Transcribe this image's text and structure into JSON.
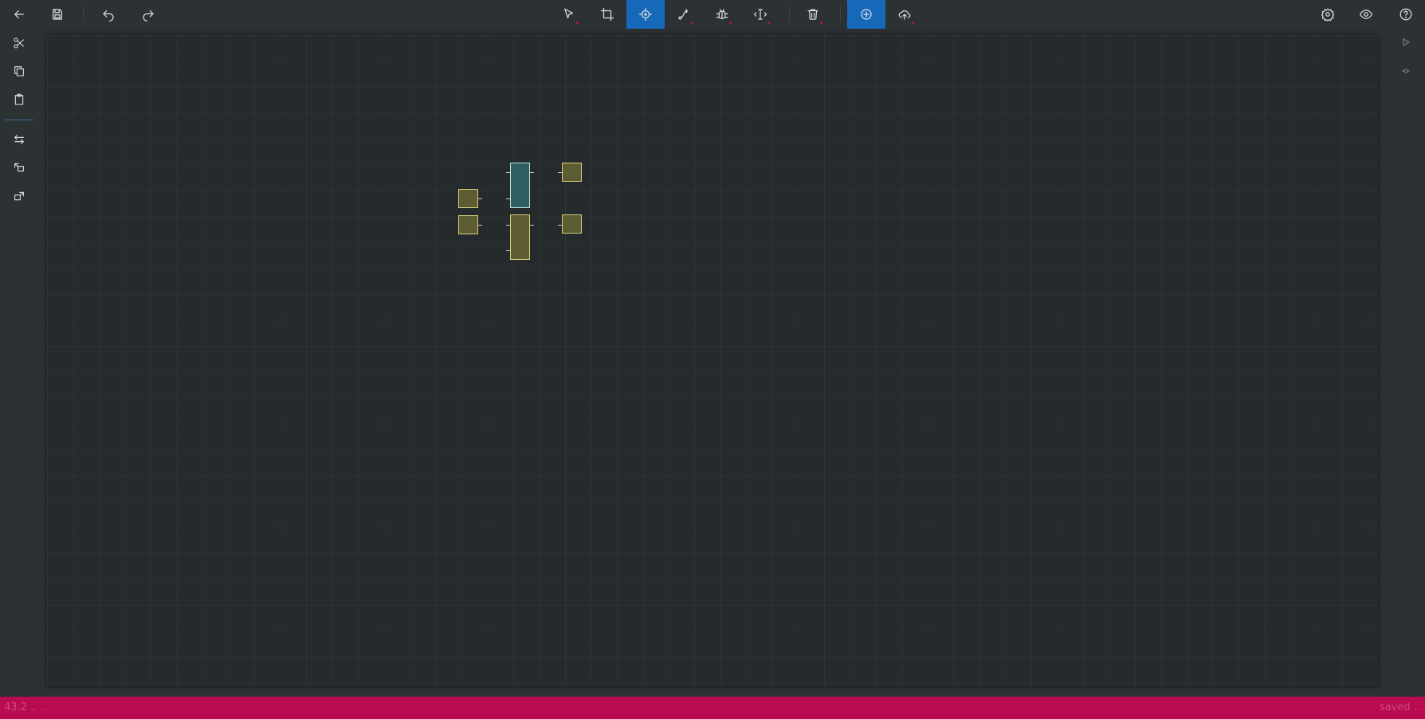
{
  "toolbar": {
    "left": [
      {
        "name": "back-button",
        "icon": "arrow-left-icon"
      },
      {
        "name": "save-button",
        "icon": "floppy-disk-icon"
      },
      {
        "name": "undo-button",
        "icon": "undo-icon"
      },
      {
        "name": "redo-button",
        "icon": "redo-icon"
      }
    ],
    "center": [
      {
        "name": "select-tool-button",
        "icon": "cursor-arrow-icon",
        "active": false
      },
      {
        "name": "crop-tool-button",
        "icon": "crop-icon",
        "active": false
      },
      {
        "name": "move-tool-button",
        "icon": "crosshair-move-icon",
        "active": true
      },
      {
        "name": "wire-tool-button",
        "icon": "wire-route-icon",
        "active": false
      },
      {
        "name": "debug-tool-button",
        "icon": "bug-icon",
        "active": false
      },
      {
        "name": "text-tool-button",
        "icon": "text-cursor-icon",
        "active": false
      },
      {
        "name": "delete-button",
        "icon": "trash-icon",
        "active": false
      },
      {
        "name": "add-component-button",
        "icon": "plus-circle-icon",
        "active": true
      },
      {
        "name": "cloud-upload-button",
        "icon": "cloud-upload-icon",
        "active": false
      }
    ],
    "right": [
      {
        "name": "settings-button",
        "icon": "gear-icon"
      },
      {
        "name": "view-button",
        "icon": "eye-icon"
      },
      {
        "name": "help-button",
        "icon": "help-circle-icon"
      }
    ]
  },
  "sidebar": {
    "items": [
      {
        "name": "cut-button",
        "icon": "scissors-icon"
      },
      {
        "name": "copy-button",
        "icon": "copy-icon"
      },
      {
        "name": "paste-button",
        "icon": "clipboard-icon"
      },
      {
        "name": "swap-button",
        "icon": "swap-arrows-icon"
      },
      {
        "name": "group-button",
        "icon": "group-icon"
      },
      {
        "name": "ungroup-button",
        "icon": "ungroup-icon"
      }
    ]
  },
  "right_panel": [
    {
      "name": "play-button",
      "icon": "play-icon"
    },
    {
      "name": "step-button",
      "icon": "step-icon"
    }
  ],
  "colors": {
    "accent": "#1669b8",
    "statusbar": "#b80b50",
    "node_fill": "#5e5c32",
    "node_selected_fill": "#2e5e61"
  },
  "status": {
    "left": "43:2  .. ..",
    "right": "saved  .."
  }
}
